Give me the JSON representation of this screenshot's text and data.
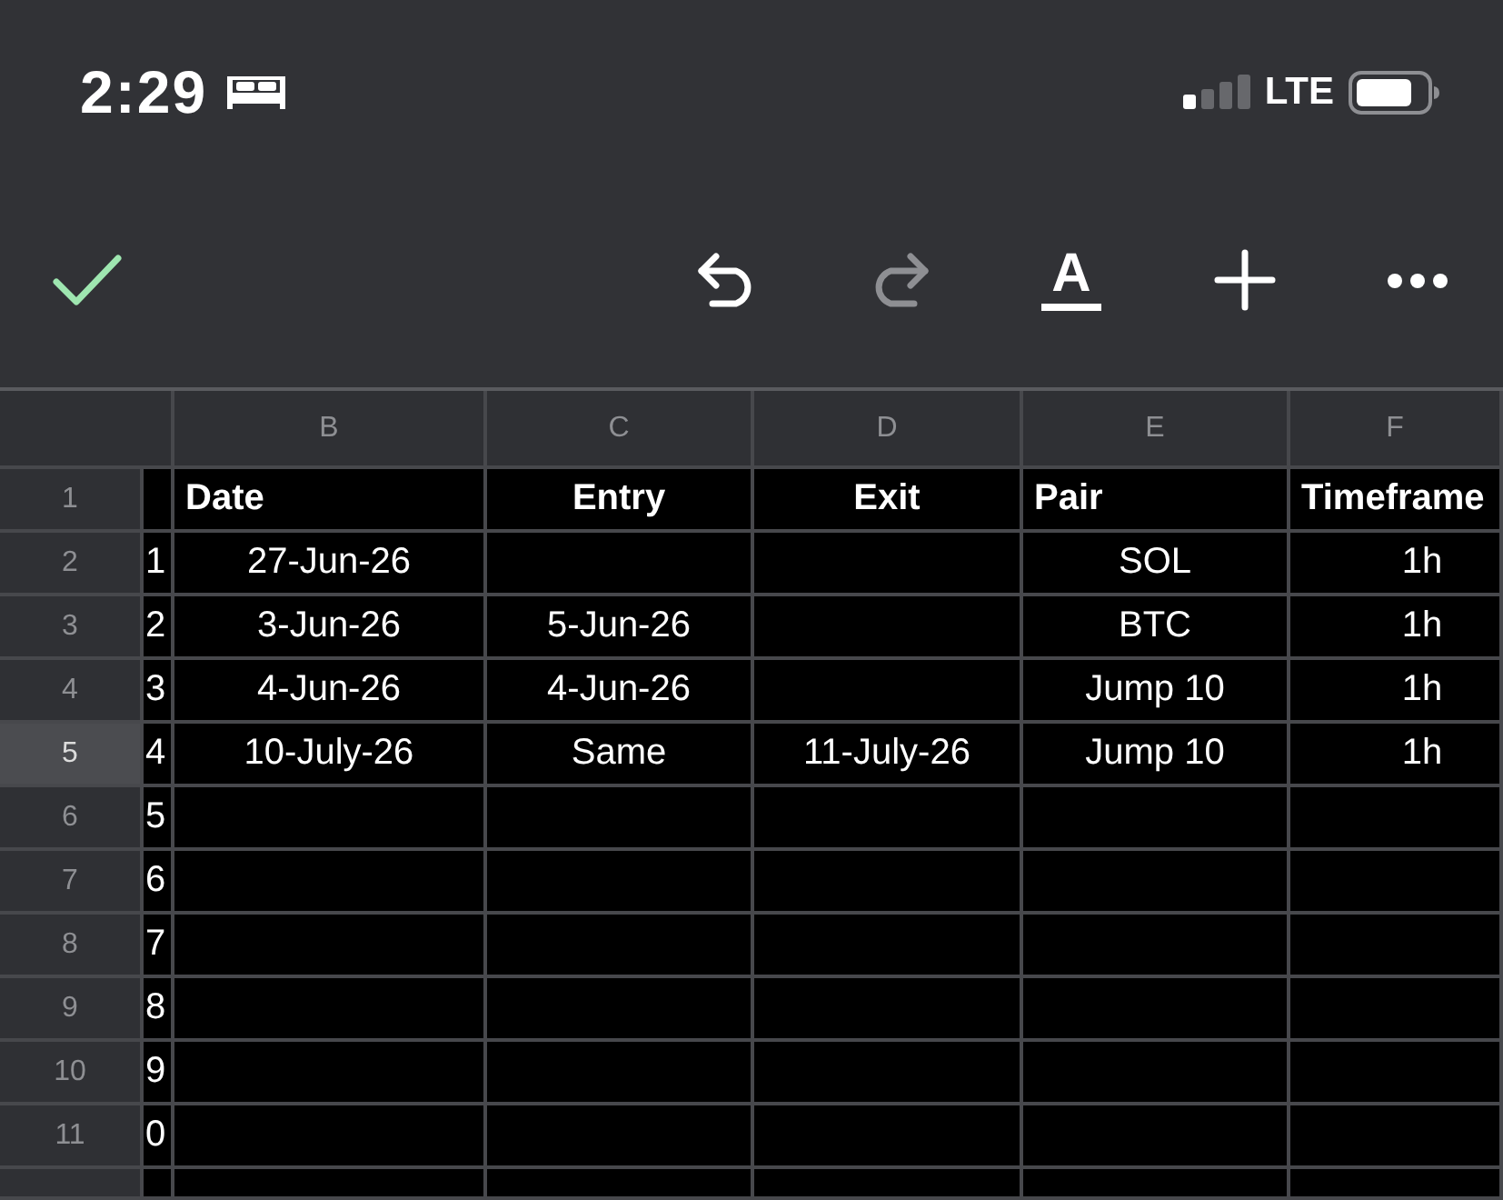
{
  "status_bar": {
    "time": "2:29",
    "network": "LTE"
  },
  "toolbar": [
    {
      "kind": "confirm",
      "disabled": false
    },
    {
      "kind": "undo",
      "disabled": false
    },
    {
      "kind": "redo",
      "disabled": true
    },
    {
      "kind": "text_color",
      "glyph": "A",
      "disabled": false
    },
    {
      "kind": "insert",
      "disabled": false
    },
    {
      "kind": "more",
      "disabled": false
    }
  ],
  "sheet": {
    "columns": [
      {
        "kind": "partial"
      },
      {
        "kind": "full",
        "letter": "B"
      },
      {
        "kind": "full",
        "letter": "C"
      },
      {
        "kind": "full",
        "letter": "D"
      },
      {
        "kind": "full",
        "letter": "E"
      },
      {
        "kind": "edge",
        "letter": "F"
      }
    ],
    "rows": [
      {
        "number": "1",
        "selected": false,
        "kind": "header",
        "cells": [
          null,
          "Date",
          "Entry",
          "Exit",
          "Pair",
          "Timeframe"
        ]
      },
      {
        "number": "2",
        "selected": false,
        "kind": "data",
        "cells": [
          "1",
          "27-Jun-26",
          null,
          null,
          "SOL",
          "1h"
        ]
      },
      {
        "number": "3",
        "selected": false,
        "kind": "data",
        "cells": [
          "2",
          "3-Jun-26",
          "5-Jun-26",
          null,
          "BTC",
          "1h"
        ]
      },
      {
        "number": "4",
        "selected": false,
        "kind": "data",
        "cells": [
          "3",
          "4-Jun-26",
          "4-Jun-26",
          null,
          "Jump 10",
          "1h"
        ]
      },
      {
        "number": "5",
        "selected": true,
        "kind": "data",
        "cells": [
          "4",
          "10-July-26",
          "Same",
          "11-July-26",
          "Jump 10",
          "1h"
        ]
      },
      {
        "number": "6",
        "selected": false,
        "kind": "data",
        "cells": [
          "5",
          null,
          null,
          null,
          null,
          null
        ]
      },
      {
        "number": "7",
        "selected": false,
        "kind": "data",
        "cells": [
          "6",
          null,
          null,
          null,
          null,
          null
        ]
      },
      {
        "number": "8",
        "selected": false,
        "kind": "data",
        "cells": [
          "7",
          null,
          null,
          null,
          null,
          null
        ]
      },
      {
        "number": "9",
        "selected": false,
        "kind": "data",
        "cells": [
          "8",
          null,
          null,
          null,
          null,
          null
        ]
      },
      {
        "number": "10",
        "selected": false,
        "kind": "data",
        "cells": [
          "9",
          null,
          null,
          null,
          null,
          null
        ]
      },
      {
        "number": "11",
        "selected": false,
        "kind": "data",
        "cells": [
          "0",
          null,
          null,
          null,
          null,
          null
        ]
      }
    ]
  }
}
